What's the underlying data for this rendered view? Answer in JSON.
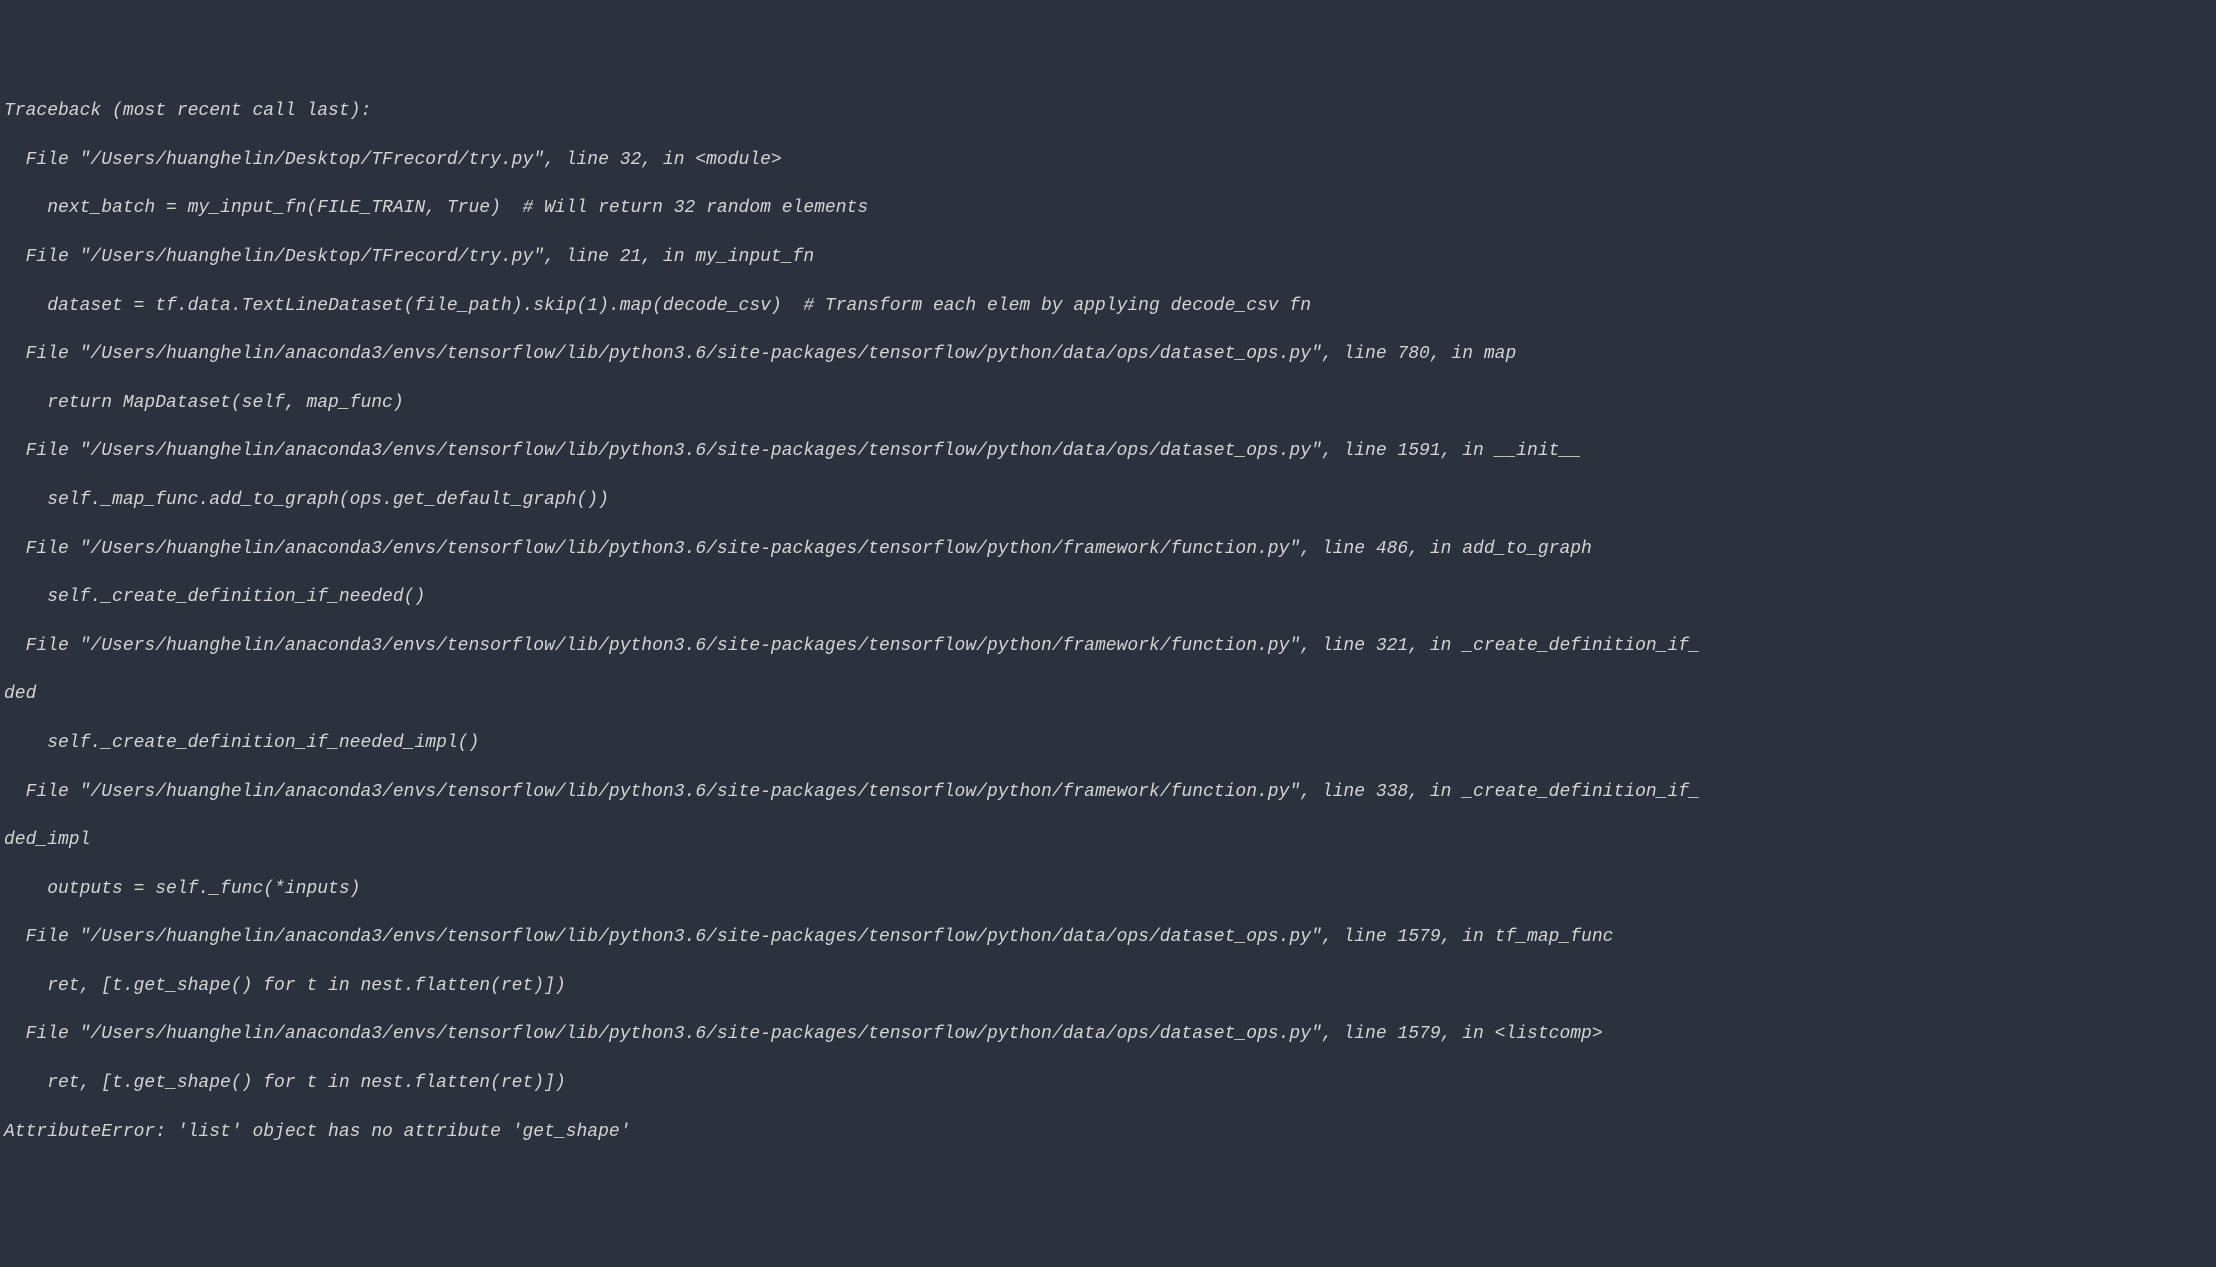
{
  "traceback": {
    "header": "Traceback (most recent call last):",
    "frames": [
      {
        "file": "  File \"/Users/huanghelin/Desktop/TFrecord/try.py\", line 32, in <module>",
        "code": "    next_batch = my_input_fn(FILE_TRAIN, True)  # Will return 32 random elements"
      },
      {
        "file": "  File \"/Users/huanghelin/Desktop/TFrecord/try.py\", line 21, in my_input_fn",
        "code": "    dataset = tf.data.TextLineDataset(file_path).skip(1).map(decode_csv)  # Transform each elem by applying decode_csv fn"
      },
      {
        "file": "  File \"/Users/huanghelin/anaconda3/envs/tensorflow/lib/python3.6/site-packages/tensorflow/python/data/ops/dataset_ops.py\", line 780, in map",
        "code": "    return MapDataset(self, map_func)"
      },
      {
        "file": "  File \"/Users/huanghelin/anaconda3/envs/tensorflow/lib/python3.6/site-packages/tensorflow/python/data/ops/dataset_ops.py\", line 1591, in __init__",
        "code": "    self._map_func.add_to_graph(ops.get_default_graph())"
      },
      {
        "file": "  File \"/Users/huanghelin/anaconda3/envs/tensorflow/lib/python3.6/site-packages/tensorflow/python/framework/function.py\", line 486, in add_to_graph",
        "code": "    self._create_definition_if_needed()"
      },
      {
        "file": "  File \"/Users/huanghelin/anaconda3/envs/tensorflow/lib/python3.6/site-packages/tensorflow/python/framework/function.py\", line 321, in _create_definition_if_",
        "cont": "ded",
        "code": "    self._create_definition_if_needed_impl()"
      },
      {
        "file": "  File \"/Users/huanghelin/anaconda3/envs/tensorflow/lib/python3.6/site-packages/tensorflow/python/framework/function.py\", line 338, in _create_definition_if_",
        "cont": "ded_impl",
        "code": "    outputs = self._func(*inputs)"
      },
      {
        "file": "  File \"/Users/huanghelin/anaconda3/envs/tensorflow/lib/python3.6/site-packages/tensorflow/python/data/ops/dataset_ops.py\", line 1579, in tf_map_func",
        "code": "    ret, [t.get_shape() for t in nest.flatten(ret)])"
      },
      {
        "file": "  File \"/Users/huanghelin/anaconda3/envs/tensorflow/lib/python3.6/site-packages/tensorflow/python/data/ops/dataset_ops.py\", line 1579, in <listcomp>",
        "code": "    ret, [t.get_shape() for t in nest.flatten(ret)])"
      }
    ],
    "error": "AttributeError: 'list' object has no attribute 'get_shape'"
  }
}
